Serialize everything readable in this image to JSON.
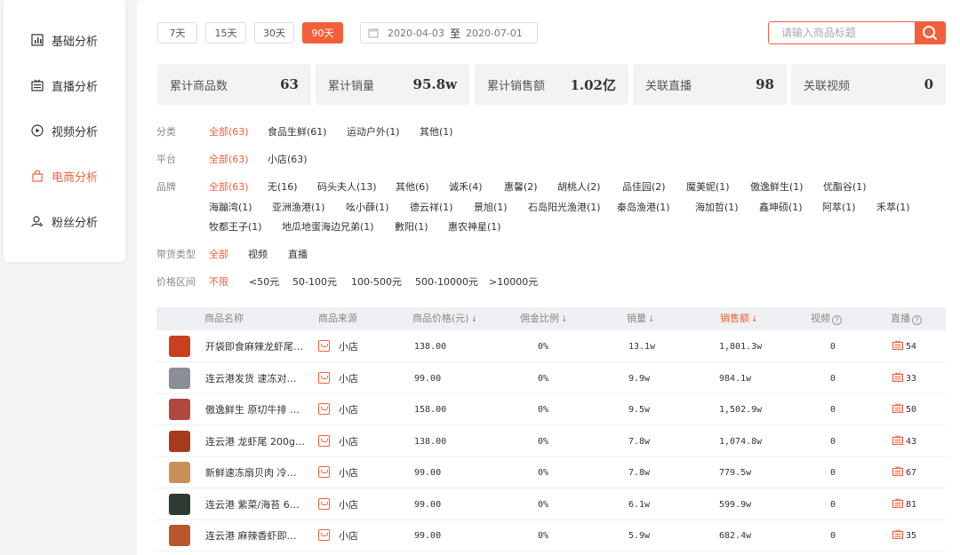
{
  "sidebar": {
    "items": [
      {
        "label": "基础分析",
        "icon": "bar-chart-icon"
      },
      {
        "label": "直播分析",
        "icon": "tv-icon"
      },
      {
        "label": "视频分析",
        "icon": "play-icon"
      },
      {
        "label": "电商分析",
        "icon": "shopping-bag-icon",
        "active": true
      },
      {
        "label": "粉丝分析",
        "icon": "user-icon"
      }
    ]
  },
  "toolbar": {
    "ranges": [
      "7天",
      "15天",
      "30天",
      "90天"
    ],
    "active_range": "90天",
    "date_start": "2020-04-03",
    "date_sep": "至",
    "date_end": "2020-07-01",
    "search_placeholder": "请输入商品标题"
  },
  "stats": [
    {
      "label": "累计商品数",
      "value": "63"
    },
    {
      "label": "累计销量",
      "value": "95.8w"
    },
    {
      "label": "累计销售额",
      "value": "1.02亿"
    },
    {
      "label": "关联直播",
      "value": "98"
    },
    {
      "label": "关联视频",
      "value": "0"
    }
  ],
  "filters": {
    "category": {
      "label": "分类",
      "options": [
        "全部(63)",
        "食品生鲜(61)",
        "运动户外(1)",
        "其他(1)"
      ]
    },
    "platform": {
      "label": "平台",
      "options": [
        "全部(63)",
        "小店(63)"
      ]
    },
    "brand": {
      "label": "品牌",
      "row1": [
        "全部(63)",
        "无(16)",
        "码头夫人(13)",
        "其他(6)",
        "诚禾(4)",
        "惠馨(2)",
        "胡桃人(2)",
        "品佳园(2)",
        "魔美妮(1)",
        "傲逸鲜生(1)",
        "优酯谷(1)"
      ],
      "row2": [
        "海蹦湾(1)",
        "亚洲渔港(1)",
        "吆小薛(1)",
        "德云祥(1)",
        "景旭(1)",
        "石岛阳光渔港(1)",
        "秦岛渔港(1)",
        "海加哲(1)",
        "鑫坤硕(1)",
        "阿萃(1)",
        "禾萃(1)"
      ],
      "row3": [
        "牧都王子(1)",
        "地瓜地蛋海边兄弟(1)",
        "數阳(1)",
        "惠农神星(1)"
      ]
    },
    "type": {
      "label": "带货类型",
      "options": [
        "全部",
        "视频",
        "直播"
      ]
    },
    "price": {
      "label": "价格区间",
      "options": [
        "不限",
        "<50元",
        "50-100元",
        "100-500元",
        "500-10000元",
        ">10000元"
      ]
    }
  },
  "table": {
    "headers": {
      "name": "商品名称",
      "source": "商品来源",
      "price": "商品价格(元)",
      "commission": "佣金比例",
      "sales": "销量",
      "revenue": "销售额",
      "video": "视频",
      "live": "直播"
    },
    "rows": [
      {
        "name": "开袋即食麻辣龙虾尾…",
        "source": "小店",
        "price": "138.00",
        "commission": "0%",
        "sales": "13.1w",
        "revenue": "1,801.3w",
        "video": "0",
        "live": "54",
        "thumb": "#c8401f"
      },
      {
        "name": "连云港发货 速冻对…",
        "source": "小店",
        "price": "99.00",
        "commission": "0%",
        "sales": "9.9w",
        "revenue": "984.1w",
        "video": "0",
        "live": "33",
        "thumb": "#8a8f96"
      },
      {
        "name": "傲逸鲜生 原切牛排 …",
        "source": "小店",
        "price": "158.00",
        "commission": "0%",
        "sales": "9.5w",
        "revenue": "1,502.9w",
        "video": "0",
        "live": "50",
        "thumb": "#b0483f"
      },
      {
        "name": "连云港 龙虾尾 200g…",
        "source": "小店",
        "price": "138.00",
        "commission": "0%",
        "sales": "7.8w",
        "revenue": "1,074.8w",
        "video": "0",
        "live": "43",
        "thumb": "#a83a1c"
      },
      {
        "name": "新鲜速冻扇贝肉 冷…",
        "source": "小店",
        "price": "99.00",
        "commission": "0%",
        "sales": "7.8w",
        "revenue": "779.5w",
        "video": "0",
        "live": "67",
        "thumb": "#c9905a"
      },
      {
        "name": "连云港 紫菜/海苔 6…",
        "source": "小店",
        "price": "99.00",
        "commission": "0%",
        "sales": "6.1w",
        "revenue": "599.9w",
        "video": "0",
        "live": "81",
        "thumb": "#2f3a33"
      },
      {
        "name": "连云港 麻辣香虾即…",
        "source": "小店",
        "price": "99.00",
        "commission": "0%",
        "sales": "5.9w",
        "revenue": "682.4w",
        "video": "0",
        "live": "35",
        "thumb": "#b9562b"
      }
    ]
  },
  "colors": {
    "accent": "#f2603a"
  }
}
